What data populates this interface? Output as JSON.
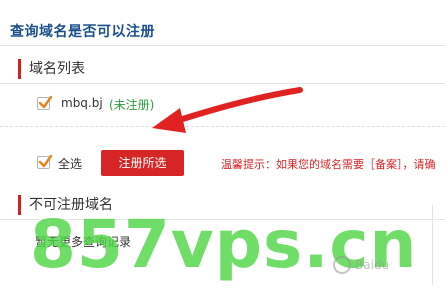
{
  "header": {
    "title": "查询域名是否可以注册"
  },
  "available_section": {
    "heading": "域名列表"
  },
  "domains": [
    {
      "name": "mbq.bj",
      "status": "(未注册)",
      "checked": true
    }
  ],
  "actions": {
    "select_all_label": "全选",
    "select_all_checked": true,
    "register_button": "注册所选",
    "tip": "温馨提示：如果您的域名需要［备案］，请确"
  },
  "unavailable_section": {
    "heading": "不可注册域名",
    "empty_message": "暂无更多查询记录"
  },
  "watermark": {
    "text": "857vps.cn",
    "brand": "Baidu"
  },
  "colors": {
    "title": "#1a4f8b",
    "accent_red": "#d62525",
    "status_green": "#2e9e3f",
    "watermark_green": "#52d648"
  }
}
